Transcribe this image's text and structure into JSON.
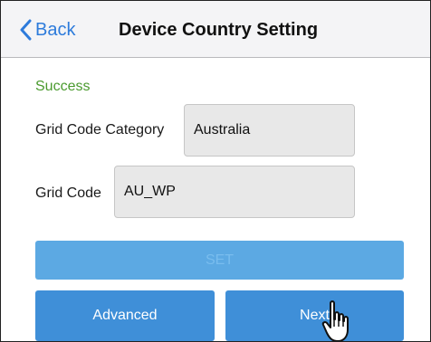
{
  "nav": {
    "back_label": "Back",
    "title": "Device Country Setting"
  },
  "status": {
    "text": "Success"
  },
  "form": {
    "grid_code_category": {
      "label": "Grid Code Category",
      "value": "Australia"
    },
    "grid_code": {
      "label": "Grid Code",
      "value": "AU_WP"
    }
  },
  "buttons": {
    "set_label": "SET",
    "advanced_label": "Advanced",
    "next_label": "Next"
  },
  "icons": {
    "back": "chevron-left-icon",
    "cursor": "hand-pointer-icon"
  },
  "colors": {
    "accent": "#2d7bdb",
    "button": "#3f8fd8",
    "button_disabled": "#5ca9e3",
    "success": "#4a9a2e"
  }
}
